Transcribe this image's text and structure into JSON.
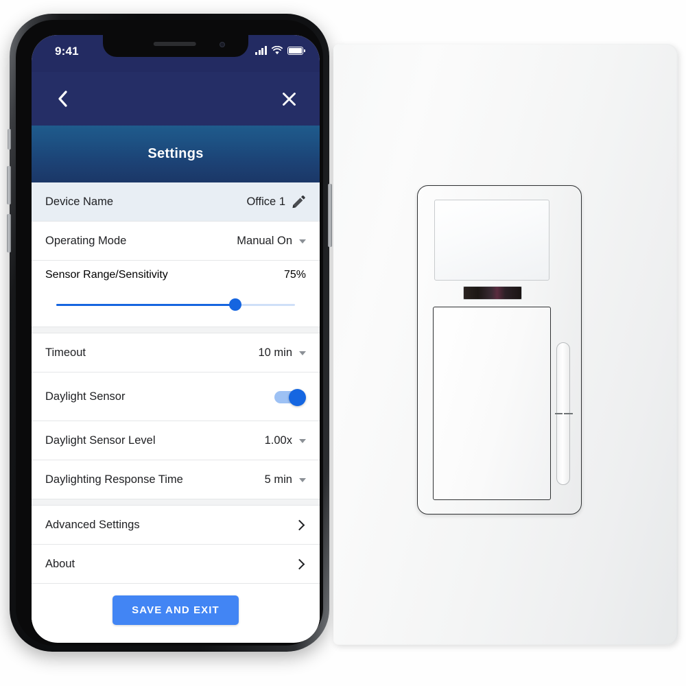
{
  "phone": {
    "status_bar": {
      "time": "9:41",
      "signal_icon": "cellular-signal-icon",
      "wifi_icon": "wifi-icon",
      "battery_icon": "battery-full-icon"
    },
    "nav": {
      "back_icon": "back-chevron-icon",
      "close_icon": "close-x-icon"
    },
    "title": "Settings"
  },
  "settings": {
    "device_name": {
      "label": "Device Name",
      "value": "Office 1",
      "edit_icon": "pencil-edit-icon"
    },
    "operating_mode": {
      "label": "Operating Mode",
      "value": "Manual On"
    },
    "sensor_range": {
      "label": "Sensor Range/Sensitivity",
      "value": "75%",
      "percent": 75
    },
    "timeout": {
      "label": "Timeout",
      "value": "10 min"
    },
    "daylight_sensor": {
      "label": "Daylight Sensor",
      "state": "on"
    },
    "daylight_sensor_level": {
      "label": "Daylight Sensor Level",
      "value": "1.00x"
    },
    "daylighting_response_time": {
      "label": "Daylighting Response Time",
      "value": "5 min"
    },
    "advanced_settings": {
      "label": "Advanced Settings",
      "chevron_icon": "chevron-right-icon"
    },
    "about": {
      "label": "About",
      "chevron_icon": "chevron-right-icon"
    },
    "save_button": "SAVE AND EXIT"
  },
  "colors": {
    "nav_navy": "#252e66",
    "title_band_top": "#1f5b8c",
    "title_band_bottom": "#1b3767",
    "accent_blue": "#1565e0",
    "save_button_blue": "#4285f4",
    "row_highlight": "#e8eef4",
    "toggle_track": "#9dc1f4",
    "toggle_knob": "#1566e1"
  },
  "wall_device": {
    "name": "occupancy-sensor-wall-switch",
    "plate": "wall-plate",
    "sensor_window": "pir-sensor-window",
    "ir_lens": "infrared-lens-strip",
    "paddle": "paddle-switch-button",
    "dimmer": "dimmer-slider-control"
  }
}
